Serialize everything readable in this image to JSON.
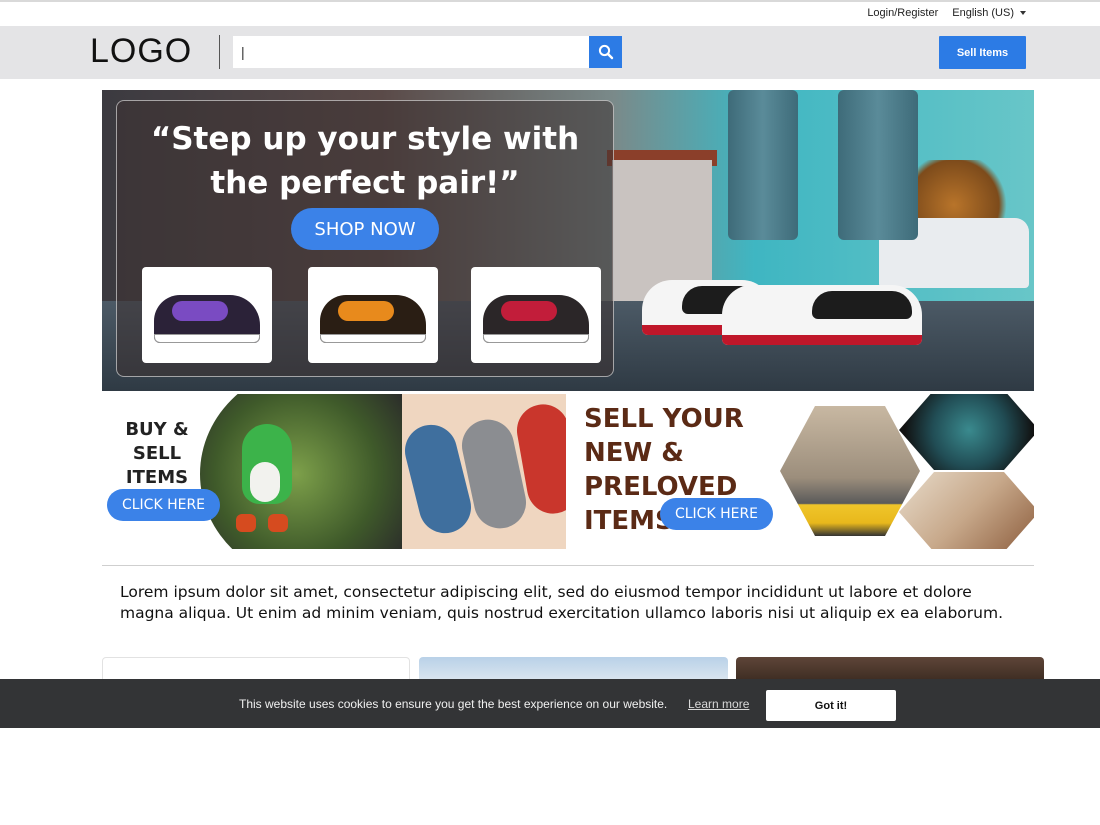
{
  "utility": {
    "login_label": "Login/Register",
    "language_label": "English (US)"
  },
  "header": {
    "logo_text": "LOGO",
    "search": {
      "value": "|",
      "placeholder": ""
    },
    "sell_label": "Sell Items"
  },
  "hero": {
    "headline": "“Step up your style with the perfect pair!”",
    "cta_label": "SHOP NOW"
  },
  "banners": {
    "left": {
      "title": "BUY & SELL ITEMS",
      "cta_label": "CLICK HERE"
    },
    "right": {
      "title": "SELL YOUR NEW & PRELOVED ITEMS",
      "cta_label": "CLICK HERE"
    }
  },
  "intro_text": "Lorem ipsum dolor sit amet, consectetur adipiscing elit, sed do eiusmod tempor incididunt ut labore et dolore magna aliqua. Ut enim ad minim veniam, quis nostrud exercitation ullamco laboris nisi ut aliquip ex ea  elaborum.",
  "cookie": {
    "message": "This website uses cookies to ensure you get the best experience on our website.",
    "learn_more_label": "Learn more",
    "accept_label": "Got it!"
  },
  "colors": {
    "accent_blue": "#2c7be5",
    "header_bg": "#e4e4e6",
    "cookie_bg": "#333436",
    "banner_title_brown": "#5b2a15"
  },
  "icons": {
    "search_button": "search-icon",
    "language_dropdown": "caret-down-icon"
  }
}
